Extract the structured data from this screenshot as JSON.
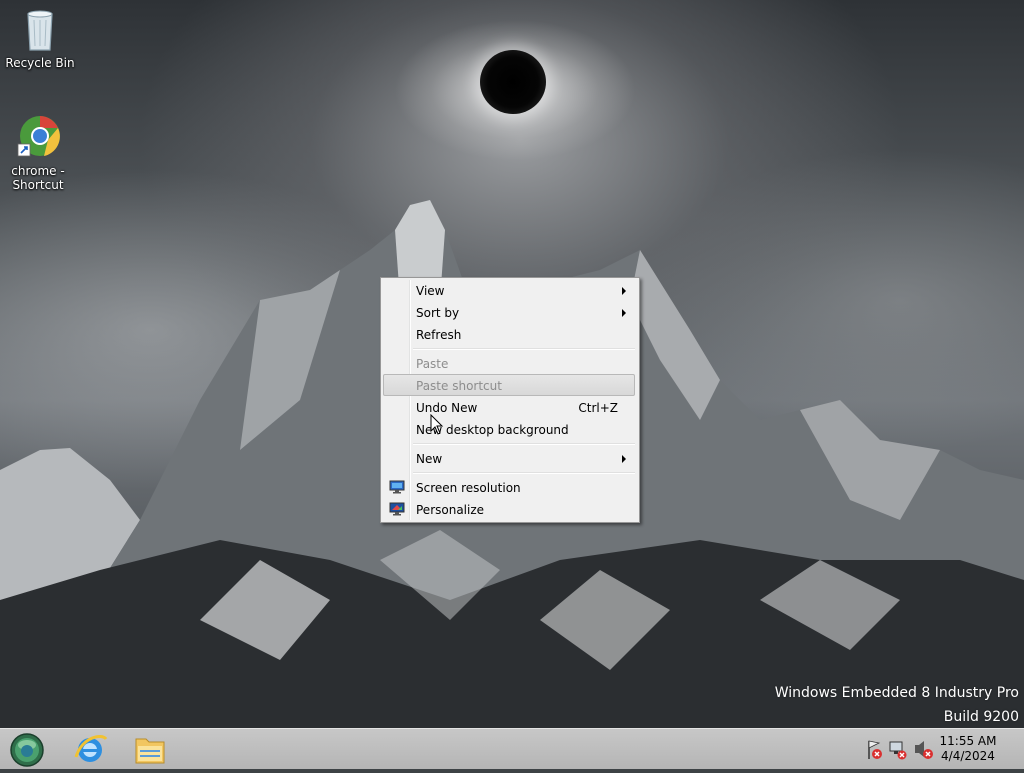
{
  "desktop": {
    "icons": [
      {
        "label": "Recycle Bin",
        "icon": "recycle-bin-icon"
      },
      {
        "label_line1": "chrome -",
        "label_line2": "Shortcut",
        "icon": "chrome-icon"
      }
    ],
    "watermark": {
      "line1": "Windows Embedded 8 Industry Pro",
      "line2": "Build 9200"
    }
  },
  "context_menu": {
    "items": [
      {
        "label": "View",
        "submenu": true,
        "enabled": true
      },
      {
        "label": "Sort by",
        "submenu": true,
        "enabled": true
      },
      {
        "label": "Refresh",
        "enabled": true
      },
      {
        "label": "Paste",
        "enabled": false
      },
      {
        "label": "Paste shortcut",
        "enabled": false,
        "highlighted": true
      },
      {
        "label": "Undo New",
        "shortcut": "Ctrl+Z",
        "enabled": true
      },
      {
        "label": "New desktop background",
        "enabled": true
      },
      {
        "label": "New",
        "submenu": true,
        "enabled": true
      },
      {
        "label": "Screen resolution",
        "icon": "display-icon",
        "enabled": true
      },
      {
        "label": "Personalize",
        "icon": "personalize-icon",
        "enabled": true
      }
    ]
  },
  "taskbar": {
    "pinned": [
      {
        "name": "start-orb",
        "icon": "start-orb-icon"
      },
      {
        "name": "internet-explorer",
        "icon": "internet-explorer-icon"
      },
      {
        "name": "file-explorer",
        "icon": "folder-icon"
      }
    ],
    "clock": {
      "time": "11:55 AM",
      "date": "4/4/2024"
    }
  },
  "colors": {
    "taskbar": "#bdbdbd",
    "menu_bg": "#f0f0f0",
    "menu_border": "#979797",
    "disabled_text": "#8d8d8d"
  }
}
